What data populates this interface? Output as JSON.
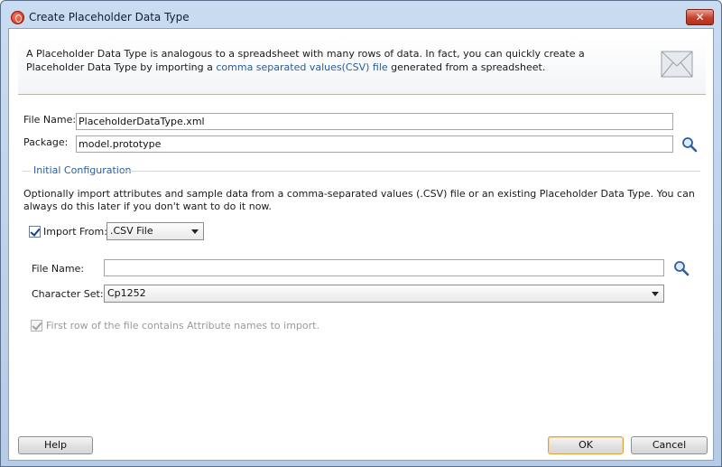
{
  "window": {
    "title": "Create Placeholder Data Type"
  },
  "header": {
    "description_part1": "A Placeholder Data Type is analogous to a spreadsheet with many rows of data. In fact, you can quickly create a Placeholder Data Type by importing a ",
    "description_link": "comma separated values(CSV) file",
    "description_part2": " generated from a spreadsheet."
  },
  "form": {
    "file_name_label": "File Name:",
    "file_name_value": "PlaceholderDataType.xml",
    "package_label": "Package:",
    "package_value": "model.prototype"
  },
  "initial_config": {
    "group_title": "Initial Configuration",
    "description": "Optionally import attributes and sample data from a comma-separated values (.CSV) file or an existing Placeholder Data Type. You can always do this later if you don't want to do it now.",
    "import_from_label": "Import From:",
    "import_from_checked": true,
    "import_from_selected": ".CSV File",
    "csv_file_name_label": "File Name:",
    "csv_file_name_value": "",
    "charset_label": "Character Set:",
    "charset_selected": "Cp1252",
    "first_row_label": "First row of the file contains Attribute names to import.",
    "first_row_checked": true
  },
  "buttons": {
    "help": "Help",
    "ok": "OK",
    "cancel": "Cancel"
  },
  "colors": {
    "link": "#2a5d9c",
    "default_button_border": "#e0a238",
    "close_button": "#c4402c"
  }
}
